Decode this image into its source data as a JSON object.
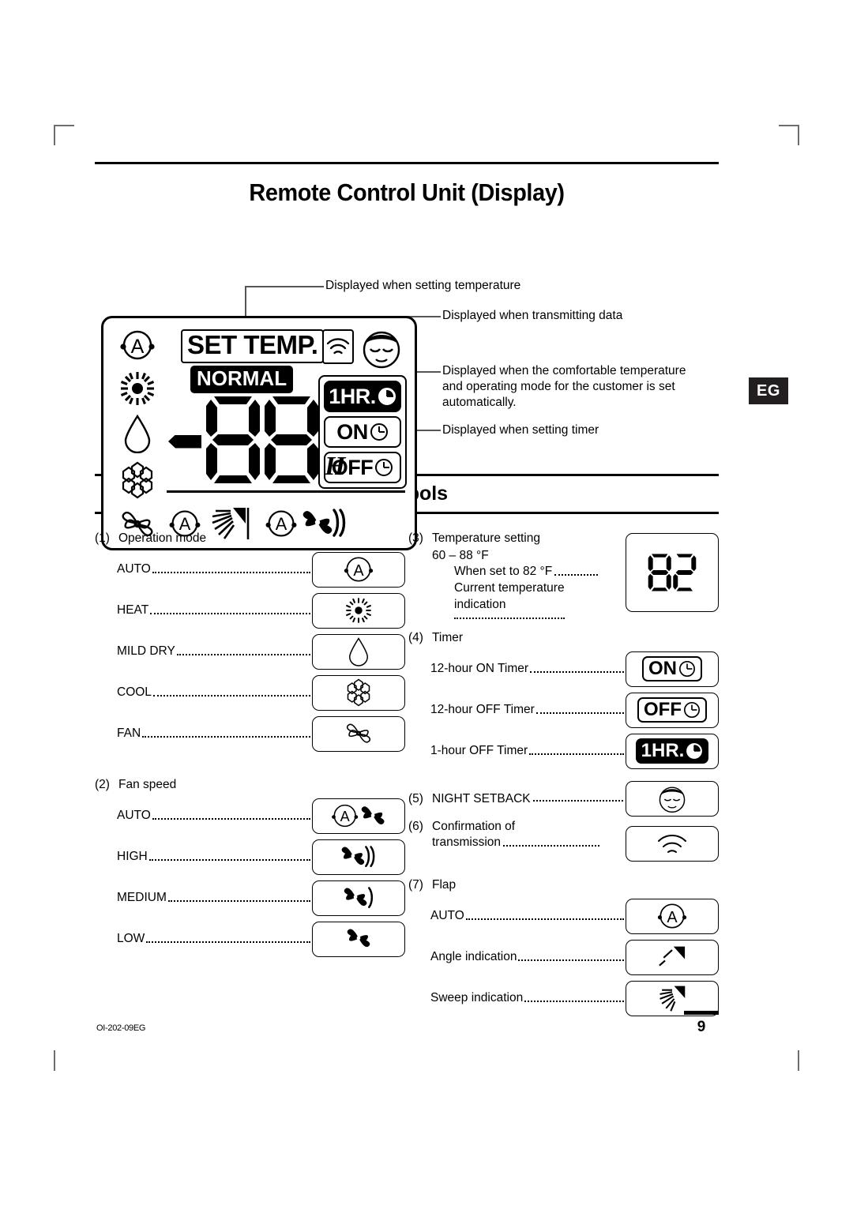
{
  "document": {
    "title": "Remote Control Unit (Display)",
    "section_title": "Symbols",
    "edition_tab": "EG",
    "footer_code": "OI-202-09EG",
    "page_number": "9"
  },
  "callouts": [
    {
      "id": "set-temperature",
      "text": "Displayed when setting temperature"
    },
    {
      "id": "transmitting-data",
      "text": "Displayed when transmitting data"
    },
    {
      "id": "comfortable-auto",
      "text": "Displayed when the comfortable temperature and operating mode for the customer is set automatically."
    },
    {
      "id": "setting-timer",
      "text": "Displayed when setting timer"
    }
  ],
  "lcd": {
    "set_temp_label": "SET TEMP.",
    "normal_badge": "NORMAL",
    "digits": "88",
    "minus_sign": "-",
    "unit": "H",
    "timers": [
      {
        "label": "1HR.",
        "inverted": true,
        "icon": "clock-icon"
      },
      {
        "label": "ON",
        "inverted": false,
        "icon": "clock-icon"
      },
      {
        "label": "OFF",
        "inverted": false,
        "icon": "clock-icon"
      }
    ],
    "mode_icons": [
      "auto-mode-icon",
      "heat-sun-icon",
      "mild-dry-droplet-icon",
      "cool-snowflake-icon",
      "fan-icon"
    ],
    "transmission_icon": "transmission-waves-icon",
    "night_setback_icon": "sleeping-face-icon",
    "bottom_row": [
      "flap-auto-icon",
      "flap-sweep-icon",
      "fan-auto-icon",
      "fan-high-icon"
    ]
  },
  "symbols": {
    "groups_left": [
      {
        "number": "(1)",
        "title": "Operation mode",
        "rows": [
          {
            "label": "AUTO",
            "icon": "auto-mode-icon"
          },
          {
            "label": "HEAT",
            "icon": "heat-sun-icon"
          },
          {
            "label": "MILD DRY",
            "icon": "mild-dry-droplet-icon"
          },
          {
            "label": "COOL",
            "icon": "cool-snowflake-icon"
          },
          {
            "label": "FAN",
            "icon": "fan-icon"
          }
        ]
      },
      {
        "number": "(2)",
        "title": "Fan speed",
        "rows": [
          {
            "label": "AUTO",
            "icon": "fan-auto-icon"
          },
          {
            "label": "HIGH",
            "icon": "fan-high-icon"
          },
          {
            "label": "MEDIUM",
            "icon": "fan-medium-icon"
          },
          {
            "label": "LOW",
            "icon": "fan-low-icon"
          }
        ]
      }
    ],
    "groups_right": [
      {
        "number": "(3)",
        "title": "Temperature setting",
        "subtitle": "60 – 88 °F",
        "rows": [
          {
            "label": "When set to 82 °F",
            "icon": "digits-82-icon"
          },
          {
            "label": "Current temperature indication",
            "icon": "digits-82-icon"
          }
        ],
        "chip_value": "82"
      },
      {
        "number": "(4)",
        "title": "Timer",
        "rows": [
          {
            "label": "12-hour ON Timer",
            "icon": "timer-on-icon",
            "chip": "ON"
          },
          {
            "label": "12-hour OFF Timer",
            "icon": "timer-off-icon",
            "chip": "OFF"
          },
          {
            "label": "1-hour OFF Timer",
            "icon": "timer-1hr-icon",
            "chip": "1HR."
          }
        ]
      },
      {
        "number": "(5)",
        "title": "NIGHT SETBACK",
        "rows": [
          {
            "label": "NIGHT SETBACK",
            "icon": "sleeping-face-icon"
          }
        ]
      },
      {
        "number": "(6)",
        "title": "Confirmation of transmission",
        "rows": [
          {
            "label": "Confirmation of transmission",
            "icon": "transmission-waves-icon"
          }
        ]
      },
      {
        "number": "(7)",
        "title": "Flap",
        "rows": [
          {
            "label": "AUTO",
            "icon": "flap-auto-icon"
          },
          {
            "label": "Angle indication",
            "icon": "flap-angle-icon"
          },
          {
            "label": "Sweep indication",
            "icon": "flap-sweep-icon"
          }
        ]
      }
    ]
  }
}
